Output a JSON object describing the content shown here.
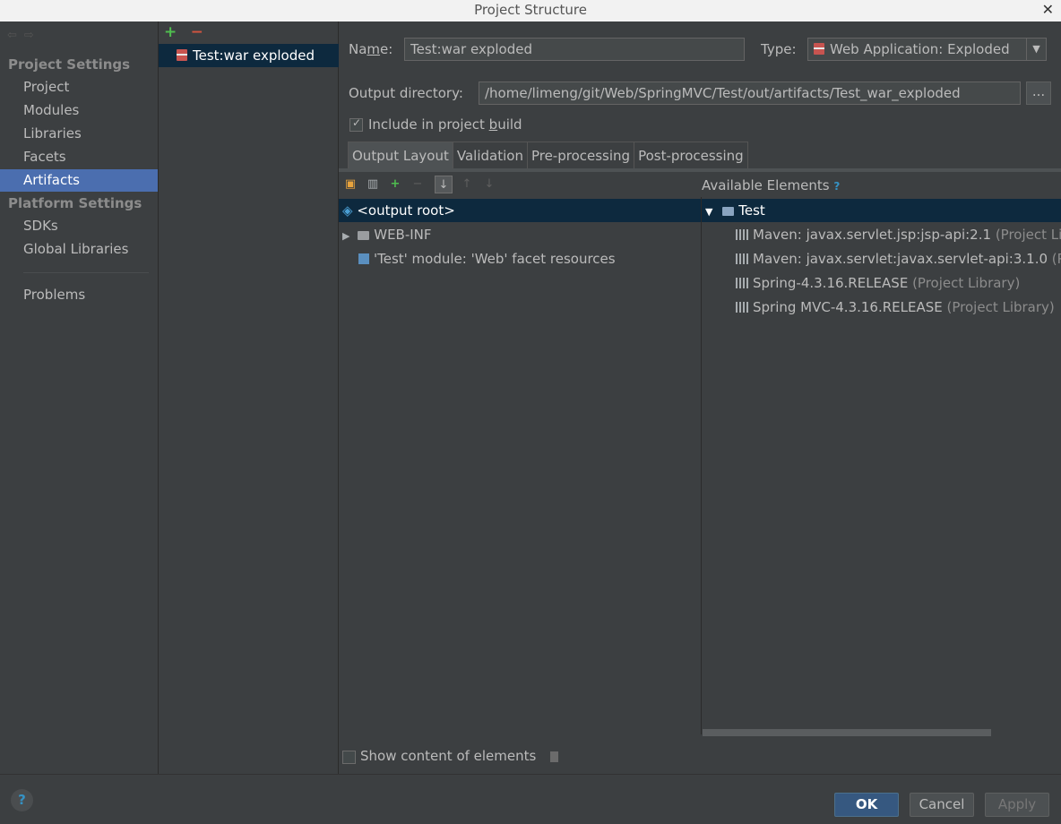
{
  "window": {
    "title": "Project Structure",
    "close": "✕"
  },
  "nav": {
    "back_forward": "⇦⇨",
    "project_settings": "Project Settings",
    "items_project": [
      "Project",
      "Modules",
      "Libraries",
      "Facets",
      "Artifacts"
    ],
    "platform_settings": "Platform Settings",
    "items_platform": [
      "SDKs",
      "Global Libraries"
    ],
    "problems": "Problems",
    "selected": "Artifacts"
  },
  "artifacts": {
    "add": "+",
    "remove": "−",
    "items": [
      "Test:war exploded"
    ]
  },
  "form": {
    "name_label_pre": "Na",
    "name_label_u": "m",
    "name_label_post": "e:",
    "name_value": "Test:war exploded",
    "type_label": "Type:",
    "type_value": "Web Application: Exploded",
    "output_dir_label": "Output directory:",
    "output_dir_value": "/home/limeng/git/Web/SpringMVC/Test/out/artifacts/Test_war_exploded",
    "browse": "...",
    "include_pre": "Include in project ",
    "include_u": "b",
    "include_post": "uild",
    "include_checked": true
  },
  "tabs": [
    "Output Layout",
    "Validation",
    "Pre-processing",
    "Post-processing"
  ],
  "layout": {
    "available_label": "Available Elements",
    "help": "?",
    "tree": [
      {
        "text": "<output root>"
      },
      {
        "text": "WEB-INF"
      },
      {
        "text": "'Test' module: 'Web' facet resources"
      }
    ],
    "available_root": "Test",
    "libraries": [
      {
        "name": "Maven: javax.servlet.jsp:jsp-api:2.1",
        "kind": "(Project Library)"
      },
      {
        "name": "Maven: javax.servlet:javax.servlet-api:3.1.0",
        "kind": "(Project Library)"
      },
      {
        "name": "Spring-4.3.16.RELEASE",
        "kind": "(Project Library)"
      },
      {
        "name": "Spring MVC-4.3.16.RELEASE",
        "kind": "(Project Library)"
      }
    ],
    "show_content": "Show content of elements"
  },
  "buttons": {
    "ok": "OK",
    "cancel": "Cancel",
    "apply": "Apply",
    "help": "?"
  }
}
